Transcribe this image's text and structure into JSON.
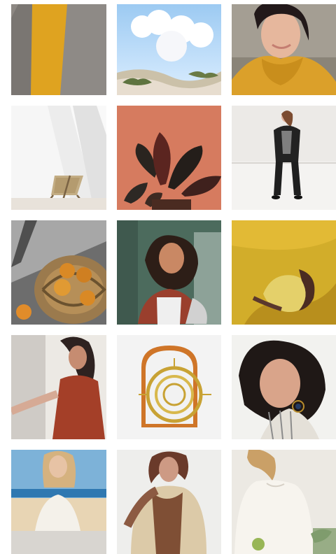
{
  "gallery": {
    "tiles": [
      {
        "name": "tile-sweaters",
        "icon": "sweaters-image"
      },
      {
        "name": "tile-dunes",
        "icon": "dunes-image"
      },
      {
        "name": "tile-mustard-sweater-woman",
        "icon": "portrait-image"
      },
      {
        "name": "tile-chair",
        "icon": "chair-image"
      },
      {
        "name": "tile-plant",
        "icon": "plant-image"
      },
      {
        "name": "tile-black-suit-woman",
        "icon": "fashion-image"
      },
      {
        "name": "tile-pears-basket",
        "icon": "still-life-image"
      },
      {
        "name": "tile-curly-hair-woman",
        "icon": "portrait-image"
      },
      {
        "name": "tile-lemon-hand",
        "icon": "fruit-image"
      },
      {
        "name": "tile-rust-top-woman",
        "icon": "portrait-image"
      },
      {
        "name": "tile-mirrors",
        "icon": "decor-image"
      },
      {
        "name": "tile-portrait-earring",
        "icon": "portrait-image"
      },
      {
        "name": "tile-beach-photo",
        "icon": "photo-image"
      },
      {
        "name": "tile-trench-woman",
        "icon": "fashion-image"
      },
      {
        "name": "tile-cream-blouse",
        "icon": "fashion-image"
      }
    ]
  },
  "colors": {
    "mustard": "#D89A1F",
    "rust": "#A3462B",
    "sage": "#5C756A",
    "cream": "#F2EEE7"
  }
}
